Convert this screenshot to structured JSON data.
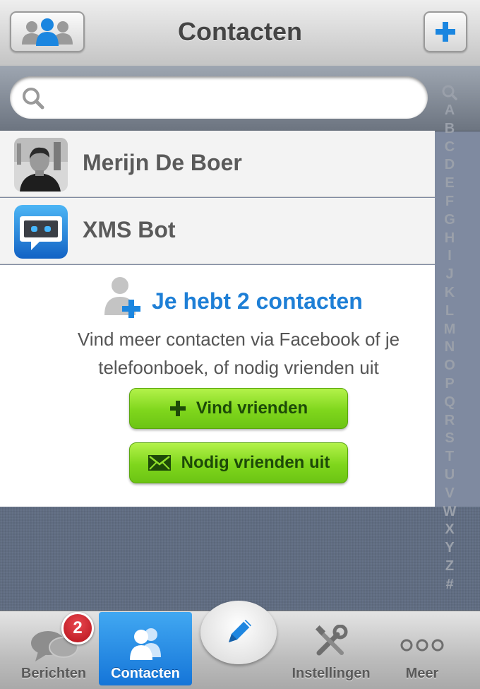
{
  "nav": {
    "title": "Contacten"
  },
  "search": {
    "placeholder": ""
  },
  "index_letters": [
    "A",
    "B",
    "C",
    "D",
    "E",
    "F",
    "G",
    "H",
    "I",
    "J",
    "K",
    "L",
    "M",
    "N",
    "O",
    "P",
    "Q",
    "R",
    "S",
    "T",
    "U",
    "V",
    "W",
    "X",
    "Y",
    "Z",
    "#"
  ],
  "contacts": [
    {
      "name": "Merijn De Boer"
    },
    {
      "name": "XMS Bot"
    }
  ],
  "empty_state": {
    "heading": "Je hebt 2 contacten",
    "desc": "Vind meer contacten via Facebook of je telefoonboek, of nodig vrienden uit",
    "find_label": "Vind vrienden",
    "invite_label": "Nodig vrienden uit"
  },
  "tabbar": {
    "messages_label": "Berichten",
    "messages_badge": "2",
    "contacts_label": "Contacten",
    "settings_label": "Instellingen",
    "more_label": "Meer"
  },
  "colors": {
    "accent": "#1e7fd6",
    "green": "#7fd61c",
    "badge": "#c4141d"
  }
}
